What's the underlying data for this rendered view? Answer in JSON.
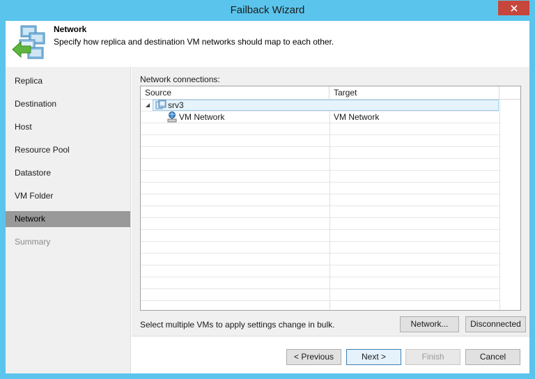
{
  "window": {
    "title": "Failback Wizard",
    "close_icon": "close-icon",
    "accent_color": "#5bc4ec"
  },
  "header": {
    "title": "Network",
    "description": "Specify how replica and destination VM networks should map to each other.",
    "icon": "failback-wizard-icon"
  },
  "sidebar": {
    "items": [
      {
        "label": "Replica",
        "state": "normal"
      },
      {
        "label": "Destination",
        "state": "normal"
      },
      {
        "label": "Host",
        "state": "normal"
      },
      {
        "label": "Resource Pool",
        "state": "normal"
      },
      {
        "label": "Datastore",
        "state": "normal"
      },
      {
        "label": "VM Folder",
        "state": "normal"
      },
      {
        "label": "Network",
        "state": "active"
      },
      {
        "label": "Summary",
        "state": "disabled"
      }
    ]
  },
  "main": {
    "connections_label": "Network connections:",
    "columns": [
      "Source",
      "Target"
    ],
    "tree": {
      "host": {
        "label": "srv3",
        "icon": "server-icon",
        "expanded": true
      },
      "networks": [
        {
          "source": "VM Network",
          "target": "VM Network",
          "icon": "network-icon"
        }
      ]
    },
    "bulk_hint": "Select multiple VMs to apply settings change in bulk.",
    "buttons": {
      "network": "Network...",
      "disconnected": "Disconnected"
    }
  },
  "footer": {
    "previous": "< Previous",
    "next": "Next >",
    "finish": "Finish",
    "cancel": "Cancel"
  }
}
